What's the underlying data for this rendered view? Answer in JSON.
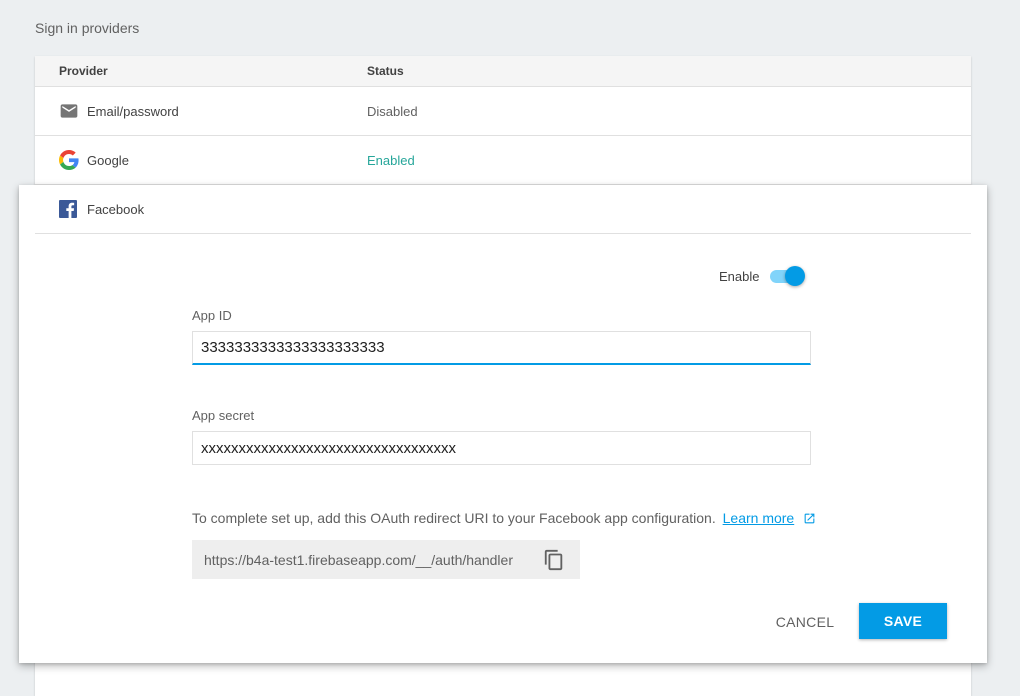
{
  "section_title": "Sign in providers",
  "table": {
    "columns": {
      "provider": "Provider",
      "status": "Status"
    },
    "rows": [
      {
        "name": "Email/password",
        "status": "Disabled",
        "icon": "mail-icon"
      },
      {
        "name": "Google",
        "status": "Enabled",
        "icon": "google-icon"
      }
    ]
  },
  "panel": {
    "provider_name": "Facebook",
    "icon": "facebook-icon",
    "enable_label": "Enable",
    "enabled": true,
    "app_id_label": "App ID",
    "app_id_value": "3333333333333333333333",
    "app_secret_label": "App secret",
    "app_secret_value": "xxxxxxxxxxxxxxxxxxxxxxxxxxxxxxxxxx",
    "help_text": "To complete set up, add this OAuth redirect URI to your Facebook app configuration.",
    "learn_more": "Learn more",
    "redirect_uri": "https://b4a-test1.firebaseapp.com/__/auth/handler",
    "cancel_label": "CANCEL",
    "save_label": "SAVE"
  },
  "colors": {
    "accent": "#039be5",
    "enabled_status": "#26a69a",
    "facebook": "#3b5998"
  }
}
